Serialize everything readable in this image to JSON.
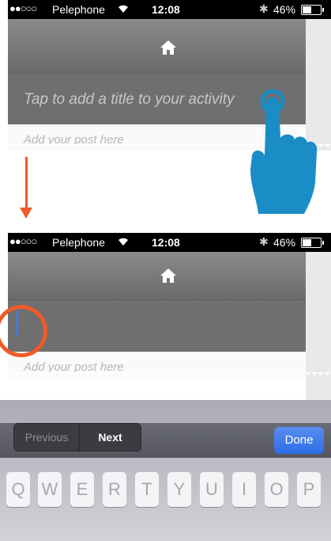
{
  "panel1": {
    "status_bar": {
      "signal_dots": "●●○○○",
      "carrier": "Pelephone",
      "time": "12:08",
      "bluetooth": "✱",
      "battery_percent": "46%"
    },
    "nav": {
      "home_icon": "home-icon"
    },
    "title_placeholder": "Tap to add a title to your activity",
    "post_placeholder": "Add your post here"
  },
  "panel2": {
    "status_bar": {
      "signal_dots": "●●○○○",
      "carrier": "Pelephone",
      "time": "12:08",
      "bluetooth": "✱",
      "battery_percent": "46%"
    },
    "nav": {
      "home_icon": "home-icon"
    },
    "post_placeholder": "Add your post here",
    "keyboard": {
      "previous_label": "Previous",
      "next_label": "Next",
      "done_label": "Done",
      "row1": [
        "Q",
        "W",
        "E",
        "R",
        "T",
        "Y",
        "U",
        "I",
        "O",
        "P"
      ]
    }
  },
  "colors": {
    "accent_annotation": "#f05a28",
    "tap_hand": "#1a8dc6",
    "done_button": "#2c6ee5",
    "cursor": "#4a78d8"
  }
}
